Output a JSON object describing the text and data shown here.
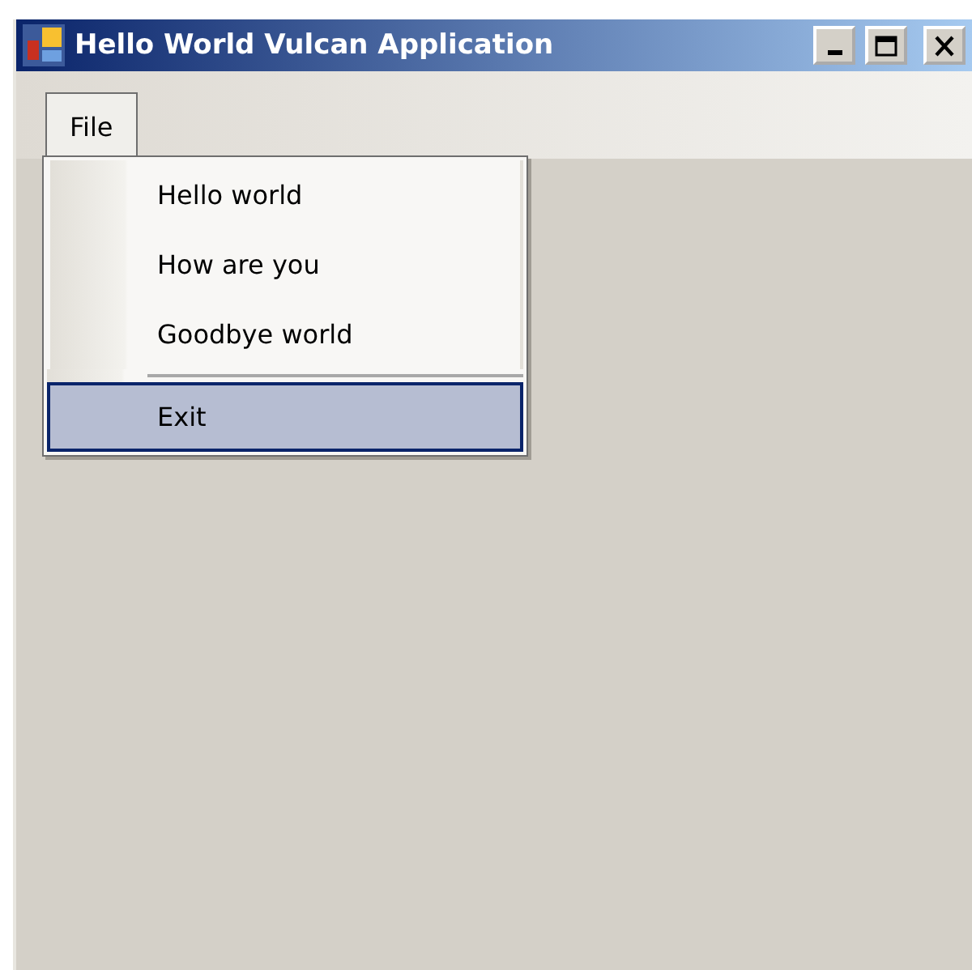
{
  "window": {
    "title": "Hello World Vulcan Application"
  },
  "title_buttons": [
    {
      "kind": "minimize"
    },
    {
      "kind": "maximize"
    },
    {
      "kind": "close"
    }
  ],
  "menu_bar": [
    {
      "label": "File",
      "expanded": true
    }
  ],
  "menu": [
    {
      "kind": "item",
      "label": "Hello world",
      "selected": false
    },
    {
      "kind": "item",
      "label": "How are you",
      "selected": false
    },
    {
      "kind": "item",
      "label": "Goodbye world",
      "selected": false
    },
    {
      "kind": "separator"
    },
    {
      "kind": "item",
      "label": "Exit",
      "selected": true
    }
  ]
}
